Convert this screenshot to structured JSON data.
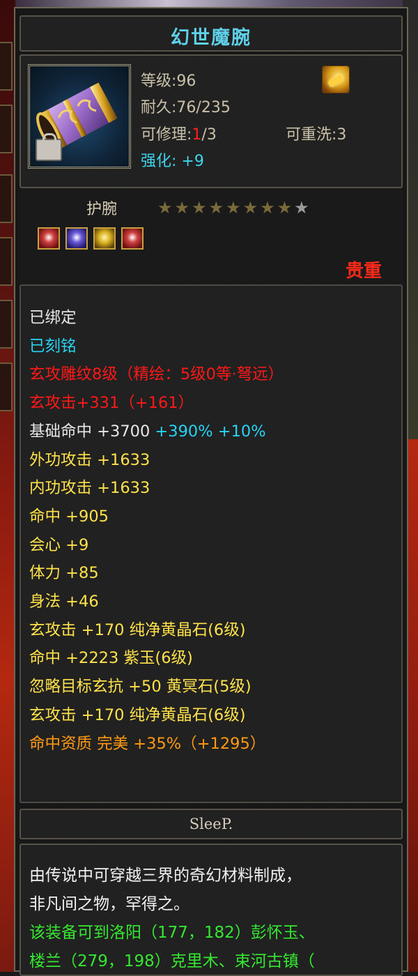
{
  "item": {
    "name": "幻世魔腕",
    "level_line": "等级:96",
    "durability_line": "耐久:76/235",
    "repair_prefix": "可修理:",
    "repair_current": "1",
    "repair_max": "/3",
    "rewash_line": "可重洗:3",
    "enhance_label": "强化: ",
    "enhance_value": "+9",
    "type": "护腕",
    "stars_filled": 8,
    "stars_total": 9,
    "rarity": "贵重",
    "gems": [
      "red-gem-icon",
      "blue-gem-icon",
      "gold-gem-icon",
      "red-gem-icon"
    ]
  },
  "attributes": [
    {
      "text": "已绑定",
      "color": "white"
    },
    {
      "text": "已刻铭",
      "color": "cyan"
    },
    {
      "text": "玄攻雕纹8级（精绘：5级0等·弩远）",
      "color": "red"
    },
    {
      "text": "玄攻击+331（+161）",
      "color": "red"
    },
    {
      "text": "基础命中 +3700",
      "extra": " +390% +10%",
      "color": "white",
      "extra_color": "cyan"
    },
    {
      "text": "外功攻击 +1633",
      "color": "yellow"
    },
    {
      "text": "内功攻击 +1633",
      "color": "yellow"
    },
    {
      "text": "命中 +905",
      "color": "yellow"
    },
    {
      "text": "会心 +9",
      "color": "yellow"
    },
    {
      "text": "体力 +85",
      "color": "yellow"
    },
    {
      "text": "身法 +46",
      "color": "yellow"
    },
    {
      "text": "玄攻击 +170 纯净黄晶石(6级)",
      "color": "yellow"
    },
    {
      "text": "命中 +2223 紫玉(6级)",
      "color": "yellow"
    },
    {
      "text": "忽略目标玄抗 +50 黄冥石(5级)",
      "color": "yellow"
    },
    {
      "text": "玄攻击 +170 纯净黄晶石(6级)",
      "color": "yellow"
    },
    {
      "text": "命中资质  完美 +35%（+1295）",
      "color": "orange"
    }
  ],
  "signature": "SleeP.",
  "description": [
    {
      "text": "由传说中可穿越三界的奇幻材料制成，",
      "color": "white"
    },
    {
      "text": "非凡间之物，罕得之。",
      "color": "white"
    },
    {
      "text": "该装备可到洛阳（177，182）彭怀玉、",
      "color": "green"
    },
    {
      "text": "楼兰（279，198）克里木、束河古镇（",
      "color": "green"
    }
  ],
  "colors": {
    "title": "#5fd0e8",
    "rarity": "#ff2a1a",
    "cyan": "#26d4f4",
    "red": "#ff1818",
    "yellow": "#ffe24a",
    "orange": "#ff9a12",
    "green": "#34e830"
  }
}
